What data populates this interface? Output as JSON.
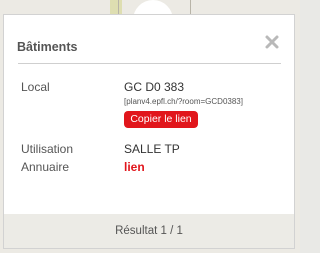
{
  "panel": {
    "title": "Bâtiments",
    "collapse_icon": "chevron-down-icon",
    "close_icon": "close-icon"
  },
  "fields": {
    "local_label": "Local",
    "local_value": "GC D0 383",
    "url_text": "[planv4.epfl.ch/?room=GCD0383]",
    "copy_button": "Copier le lien",
    "utilisation_label": "Utilisation",
    "utilisation_value": "SALLE TP",
    "annuaire_label": "Annuaire",
    "annuaire_link": "lien"
  },
  "footer": {
    "result_text": "Résultat 1 / 1"
  },
  "colors": {
    "accent": "#e1161c",
    "text": "#555555",
    "footer_bg": "#ecebe6"
  }
}
